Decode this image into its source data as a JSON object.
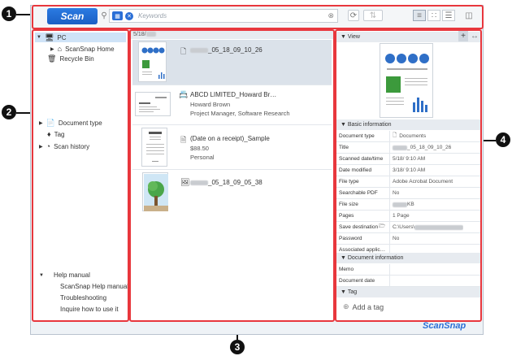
{
  "callouts": [
    "1",
    "2",
    "3",
    "4"
  ],
  "toolbar": {
    "scan_label": "Scan",
    "search_placeholder": "Keywords"
  },
  "left": {
    "pc": "PC",
    "scansnap_home": "ScanSnap Home",
    "recycle_bin": "Recycle Bin",
    "document_type": "Document type",
    "tag": "Tag",
    "scan_history": "Scan history",
    "help_manual": "Help manual",
    "help_items": [
      "ScanSnap Help manual",
      "Troubleshooting",
      "Inquire how to use it"
    ]
  },
  "list": {
    "date_header": "5/18/",
    "docs": [
      {
        "title": "_05_18_09_10_26"
      },
      {
        "title": "ABCD LIMITED_Howard Br…",
        "line1": "Howard Brown",
        "line2": "Project Manager, Software Research"
      },
      {
        "title": "(Date on a receipt)_Sample",
        "line1": "$88.50",
        "line2": "Personal"
      },
      {
        "title": "_05_18_09_05_38"
      }
    ]
  },
  "right": {
    "view_label": "View",
    "basic_info": "Basic information",
    "rows": [
      {
        "k": "Document type",
        "v": "Documents"
      },
      {
        "k": "Title",
        "v": "_05_18_09_10_26"
      },
      {
        "k": "Scanned date/time",
        "v": "5/18/      9:10 AM"
      },
      {
        "k": "Date modified",
        "v": "3/18/      9:10 AM"
      },
      {
        "k": "File type",
        "v": "Adobe Acrobat Document"
      },
      {
        "k": "Searchable PDF",
        "v": "No"
      },
      {
        "k": "File size",
        "v": "KB"
      },
      {
        "k": "Pages",
        "v": "1 Page"
      },
      {
        "k": "Save destination",
        "v": "C:\\Users\\"
      },
      {
        "k": "Password",
        "v": "No"
      },
      {
        "k": "Associated applic…",
        "v": ""
      }
    ],
    "doc_info": "Document information",
    "memo": "Memo",
    "doc_date": "Document date",
    "tag_section": "Tag",
    "add_tag": "Add a tag"
  },
  "footer": {
    "brand": "ScanSnap"
  },
  "colors": {
    "accent": "#1a5fc4",
    "callout_border": "#e8373d"
  }
}
